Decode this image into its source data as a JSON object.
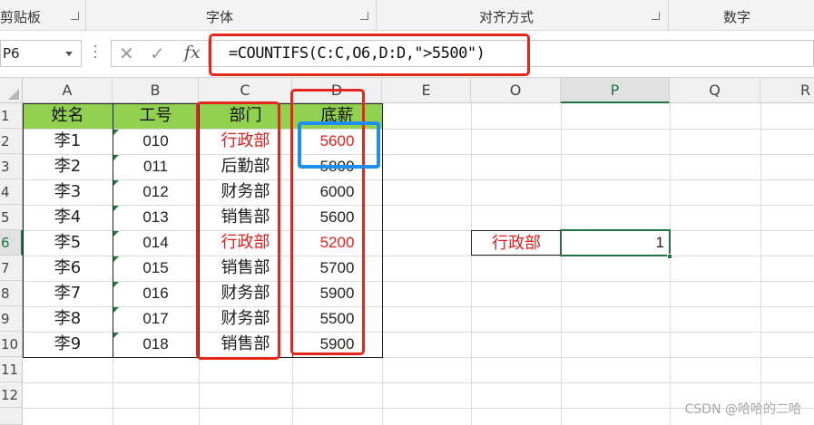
{
  "ribbon": {
    "groups": [
      {
        "label": "剪贴板"
      },
      {
        "label": "字体"
      },
      {
        "label": "对齐方式"
      },
      {
        "label": "数字"
      }
    ]
  },
  "formula_bar": {
    "name_box": "P6",
    "cancel_icon": "✕",
    "enter_icon": "✓",
    "fx_label": "fx",
    "formula": "=COUNTIFS(C:C,O6,D:D,\">5500\")"
  },
  "columns": [
    "A",
    "B",
    "C",
    "D",
    "E",
    "O",
    "P",
    "Q",
    "R"
  ],
  "rows": [
    "1",
    "2",
    "3",
    "4",
    "5",
    "6",
    "7",
    "8",
    "9",
    "10",
    "11",
    "12"
  ],
  "table": {
    "headers": [
      "姓名",
      "工号",
      "部门",
      "底薪"
    ],
    "rows": [
      {
        "name": "李1",
        "id": "010",
        "dept": "行政部",
        "salary": "5600"
      },
      {
        "name": "李2",
        "id": "011",
        "dept": "后勤部",
        "salary": "5800"
      },
      {
        "name": "李3",
        "id": "012",
        "dept": "财务部",
        "salary": "6000"
      },
      {
        "name": "李4",
        "id": "013",
        "dept": "销售部",
        "salary": "5600"
      },
      {
        "name": "李5",
        "id": "014",
        "dept": "行政部",
        "salary": "5200"
      },
      {
        "name": "李6",
        "id": "015",
        "dept": "销售部",
        "salary": "5700"
      },
      {
        "name": "李7",
        "id": "016",
        "dept": "财务部",
        "salary": "5900"
      },
      {
        "name": "李8",
        "id": "017",
        "dept": "财务部",
        "salary": "5500"
      },
      {
        "name": "李9",
        "id": "018",
        "dept": "销售部",
        "salary": "5900"
      }
    ]
  },
  "criteria": {
    "o6": "行政部",
    "p6": "1"
  },
  "colors": {
    "header_fill": "#92d050",
    "highlight_red": "#e3261e",
    "highlight_blue": "#1e8ff0",
    "accent": "#217346",
    "text_red": "#e0201c"
  },
  "watermark": "CSDN @哈哈的二哈"
}
